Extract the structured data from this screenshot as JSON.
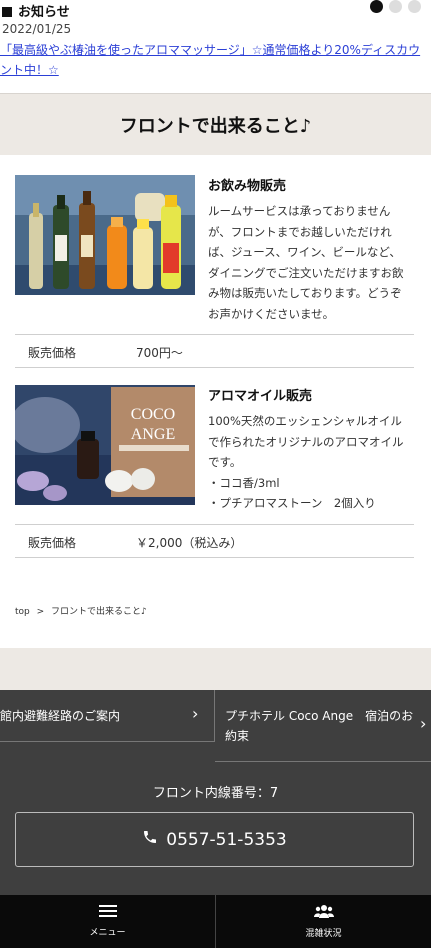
{
  "news": {
    "heading": "お知らせ",
    "date": "2022/01/25",
    "link_text": "「最高級やぶ椿油を使ったアロママッサージ」☆通常価格より20%ディスカウント中！☆",
    "carousel_dots": 3,
    "active_dot": 0
  },
  "page_title": "フロントで出来ること♪",
  "items": [
    {
      "title": "お飲み物販売",
      "description": "ルームサービスは承っておりませんが、フロントまでお越しいただければ、ジュース、ワイン、ビールなど、ダイニングでご注文いただけますお飲み物は販売いたしております。どうぞお声かけくださいませ。",
      "price_label": "販売価格",
      "price": "700円〜"
    },
    {
      "title": "アロマオイル販売",
      "description": "100%天然のエッシェンシャルオイルで作られたオリジナルのアロマオイルです。\n・ココ香/3ml\n・プチアロマストーン　2個入り",
      "price_label": "販売価格",
      "price": "￥2,000（税込み）",
      "image_logo_top": "COCO",
      "image_logo_bottom": "ANGE"
    }
  ],
  "breadcrumb": {
    "home": "top",
    "separator": ">",
    "current": "フロントで出来ること♪"
  },
  "footer": {
    "link_left": "館内避難経路のご案内",
    "link_right": "プチホテル Coco Ange　宿泊のお約束",
    "extension_label": "フロント内線番号：7",
    "phone": "0557-51-5353"
  },
  "bottom_nav": {
    "menu_label": "メニュー",
    "status_label": "混雑状況"
  },
  "colors": {
    "link": "#2b3fd6",
    "beige": "#ede9e4",
    "footer_bg": "#3f3f3f",
    "nav_bg": "#0a0a0a"
  }
}
